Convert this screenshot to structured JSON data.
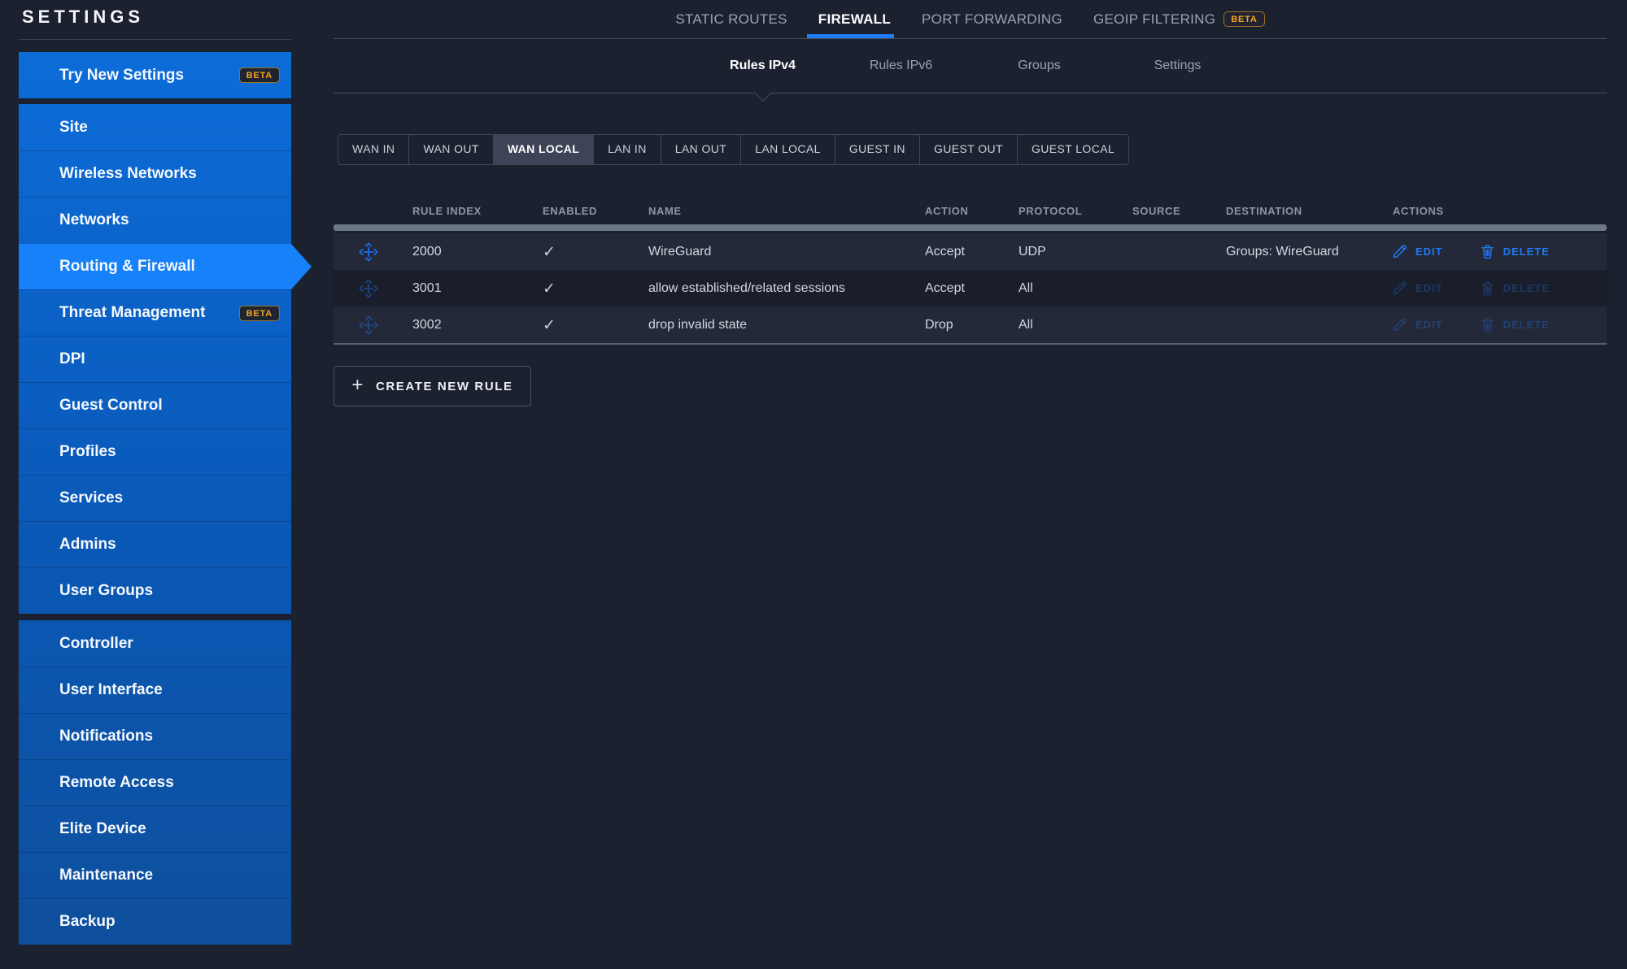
{
  "colors": {
    "accent_blue": "#1f7ef5",
    "sidebar_active_blue": "#1681f8",
    "sidebar_gradient_top": "#0c6cd8",
    "sidebar_gradient_bottom": "#0e4f9c",
    "beta_orange": "#f3a41f",
    "page_background": "#1c2130"
  },
  "sidebar": {
    "title": "SETTINGS",
    "beta_label": "BETA",
    "sections": [
      {
        "items": [
          {
            "label": "Try New Settings",
            "beta": true
          }
        ]
      },
      {
        "items": [
          {
            "label": "Site"
          },
          {
            "label": "Wireless Networks"
          },
          {
            "label": "Networks"
          },
          {
            "label": "Routing & Firewall",
            "active": true
          },
          {
            "label": "Threat Management",
            "beta": true
          },
          {
            "label": "DPI"
          },
          {
            "label": "Guest Control"
          },
          {
            "label": "Profiles"
          },
          {
            "label": "Services"
          },
          {
            "label": "Admins"
          },
          {
            "label": "User Groups"
          }
        ]
      },
      {
        "items": [
          {
            "label": "Controller"
          },
          {
            "label": "User Interface"
          },
          {
            "label": "Notifications"
          },
          {
            "label": "Remote Access"
          },
          {
            "label": "Elite Device"
          },
          {
            "label": "Maintenance"
          },
          {
            "label": "Backup"
          }
        ]
      }
    ]
  },
  "top_nav": {
    "beta_label": "BETA",
    "tabs": [
      {
        "label": "STATIC ROUTES"
      },
      {
        "label": "FIREWALL",
        "active": true
      },
      {
        "label": "PORT FORWARDING"
      },
      {
        "label": "GEOIP FILTERING",
        "beta": true
      }
    ]
  },
  "sub_nav": {
    "tabs": [
      {
        "label": "Rules IPv4",
        "active": true
      },
      {
        "label": "Rules IPv6"
      },
      {
        "label": "Groups"
      },
      {
        "label": "Settings"
      }
    ]
  },
  "filters": {
    "buttons": [
      {
        "label": "WAN IN"
      },
      {
        "label": "WAN OUT"
      },
      {
        "label": "WAN LOCAL",
        "active": true
      },
      {
        "label": "LAN IN"
      },
      {
        "label": "LAN OUT"
      },
      {
        "label": "LAN LOCAL"
      },
      {
        "label": "GUEST IN"
      },
      {
        "label": "GUEST OUT"
      },
      {
        "label": "GUEST LOCAL"
      }
    ]
  },
  "table": {
    "headers": {
      "rule_index": "RULE INDEX",
      "enabled": "ENABLED",
      "name": "NAME",
      "action": "ACTION",
      "protocol": "PROTOCOL",
      "source": "SOURCE",
      "destination": "DESTINATION",
      "actions": "ACTIONS"
    },
    "check_glyph": "✓",
    "edit_label": "EDIT",
    "delete_label": "DELETE",
    "rows": [
      {
        "rule_index": "2000",
        "enabled": "✓",
        "name": "WireGuard",
        "action": "Accept",
        "protocol": "UDP",
        "source": "",
        "destination": "Groups: WireGuard",
        "actions_enabled": true
      },
      {
        "rule_index": "3001",
        "enabled": "✓",
        "name": "allow established/related sessions",
        "action": "Accept",
        "protocol": "All",
        "source": "",
        "destination": "",
        "actions_enabled": false
      },
      {
        "rule_index": "3002",
        "enabled": "✓",
        "name": "drop invalid state",
        "action": "Drop",
        "protocol": "All",
        "source": "",
        "destination": "",
        "actions_enabled": false
      }
    ]
  },
  "create_rule": {
    "label": "CREATE NEW RULE",
    "plus_glyph": "+"
  }
}
